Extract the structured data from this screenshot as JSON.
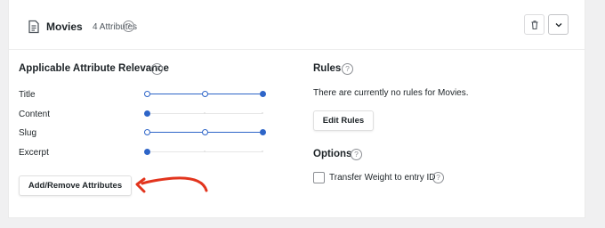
{
  "header": {
    "engine_name": "Movies",
    "attribute_count": "4 Attributes",
    "help": "?",
    "icons": [
      "document-icon",
      "help-icon",
      "trash-icon",
      "chevron-down-icon"
    ]
  },
  "relevance": {
    "title": "Applicable Attribute Relevance",
    "help": "?",
    "attributes": [
      {
        "label": "Title",
        "level": 1.0
      },
      {
        "label": "Content",
        "level": 0.0
      },
      {
        "label": "Slug",
        "level": 1.0
      },
      {
        "label": "Excerpt",
        "level": 0.0
      }
    ],
    "add_remove_label": "Add/Remove Attributes"
  },
  "rules": {
    "title": "Rules",
    "help": "?",
    "empty_text": "There are currently no rules for Movies.",
    "edit_label": "Edit Rules"
  },
  "options": {
    "title": "Options",
    "help": "?",
    "transfer_weight_label": "Transfer Weight to entry ID",
    "transfer_weight_checked": false,
    "help2": "?"
  },
  "colors": {
    "accent": "#2e65c8",
    "annotation_arrow": "#e2341d"
  }
}
